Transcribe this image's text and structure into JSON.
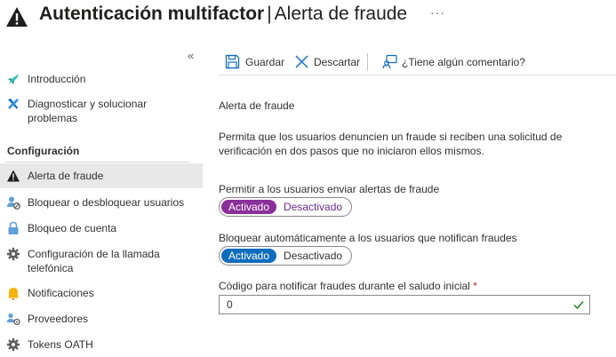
{
  "header": {
    "title_main": "Autenticación multifactor",
    "title_sep": "|",
    "title_sub": "Alerta de fraude",
    "more": "···",
    "collapse": "«"
  },
  "sidebar": {
    "items_top": [
      {
        "label": "Introducción",
        "icon": "rocket-icon"
      },
      {
        "label": "Diagnosticar y solucionar problemas",
        "icon": "wrench-icon"
      }
    ],
    "section_label": "Configuración",
    "items": [
      {
        "label": "Alerta de fraude",
        "icon": "warning-icon",
        "selected": true
      },
      {
        "label": "Bloquear o desbloquear usuarios",
        "icon": "user-block-icon"
      },
      {
        "label": "Bloqueo de cuenta",
        "icon": "lock-icon"
      },
      {
        "label": "Configuración de la llamada telefónica",
        "icon": "gear-icon"
      },
      {
        "label": "Notificaciones",
        "icon": "bell-icon"
      },
      {
        "label": "Proveedores",
        "icon": "providers-icon"
      },
      {
        "label": "Tokens OATH",
        "icon": "gear-icon"
      }
    ]
  },
  "toolbar": {
    "save_label": "Guardar",
    "discard_label": "Descartar",
    "feedback_label": "¿Tiene algún comentario?"
  },
  "main": {
    "heading": "Alerta de fraude",
    "description": "Permita que los usuarios denuncien un fraude si reciben una solicitud de verificación en dos pasos que no iniciaron ellos mismos.",
    "allow_alerts": {
      "label": "Permitir a los usuarios enviar alertas de fraude",
      "on": "Activado",
      "off": "Desactivado",
      "value": "Activado"
    },
    "auto_block": {
      "label": "Bloquear automáticamente a los usuarios que notifican fraudes",
      "on": "Activado",
      "off": "Desactivado",
      "value": "Activado"
    },
    "code": {
      "label": "Código para notificar fraudes durante el saludo inicial",
      "required_mark": "*",
      "value": "0"
    }
  },
  "colors": {
    "toggle1_active": "#8a2f9a",
    "toggle2_active": "#0f6cbd",
    "accent": "#0f6cbd",
    "valid_check": "#107c10"
  }
}
